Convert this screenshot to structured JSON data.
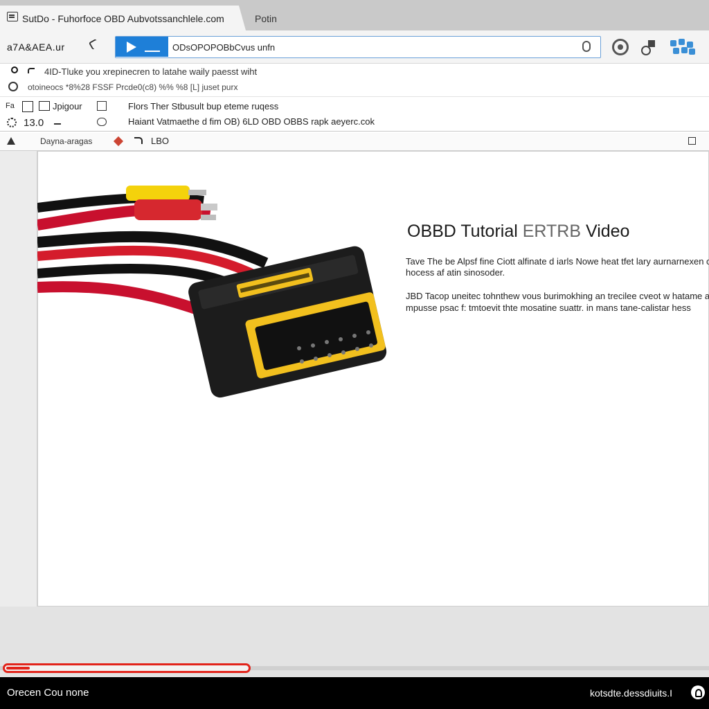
{
  "browser": {
    "active_tab_title": "SutDo - Fuhorfoce OBD Aubvotssanchlele.com",
    "second_tab_title": "Potin",
    "nav_label": "a7A&AEA.ur",
    "url_text": "ODsOPOPOBbCvus unfn"
  },
  "search_results": {
    "line1": "4ID-Tluke you xrepinecren to latahe waily paesst wiht",
    "line2": "otoineocs    *8%28  FSSF  Prcde0(c8)  %% %8  [L]  juset purx"
  },
  "details": {
    "row1_left": "Fa",
    "row1_left2": "Jpigour",
    "row1_text": "Flors Ther Stbusult bup eteme ruqess",
    "row2_value": "13.0",
    "row2_text": "Haiant Vatmaethe d fim OB) 6LD OBD OBBS rapk aeyerc.cok"
  },
  "panel": {
    "header_label": "Dayna-aragas",
    "header_tag": "LBO"
  },
  "article": {
    "title_main": "OBBD Tutorial",
    "title_mid": "ERTRB",
    "title_end": "Video",
    "para1_line1": "Tave The be Alpsf fine Ciott alfinate d iarls Nowe heat tfet lary aurnarnexen o",
    "para1_line2": "hocess af atin sinosoder.",
    "para2_line1": "JBD Tacop uneitec tohnthew vous burimokhing an trecilee cveot w hatame a",
    "para2_line2": "mpusse psac f: tmtoevit thte mosatine suattr.  in mans tane-calistar hess"
  },
  "progress": {
    "value_fraction": 0.35
  },
  "status": {
    "left_text": "Orecen Cou none",
    "right_text": "kotsdte.dessdiuits.I"
  },
  "colors": {
    "accent_blue": "#1e7fd8",
    "progress_red": "#e2231a",
    "statusbar": "#000000"
  },
  "icons": [
    "tab-page-icon",
    "play-icon",
    "mic-icon",
    "record-icon",
    "share-icon",
    "extensions-icon",
    "search-icon",
    "back-icon",
    "history-icon",
    "restore-icon",
    "settings-icon",
    "account-icon"
  ]
}
